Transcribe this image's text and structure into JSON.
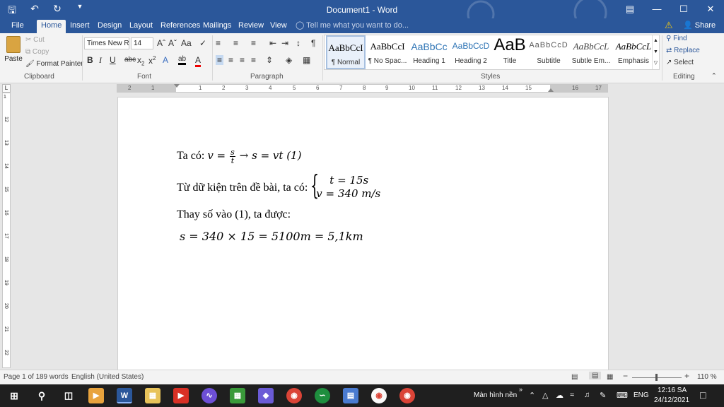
{
  "window": {
    "title": "Document1 - Word",
    "qat": {
      "save_icon": "save-icon",
      "undo_icon": "undo-icon",
      "redo_icon": "redo-icon",
      "customize_icon": "customize-qat-icon"
    },
    "controls": {
      "ribbon_display": "ribbon-display-icon",
      "minimize": "minimize-icon",
      "maximize": "maximize-icon",
      "close": "close-icon"
    }
  },
  "tabs": [
    {
      "label": "File"
    },
    {
      "label": "Home"
    },
    {
      "label": "Insert"
    },
    {
      "label": "Design"
    },
    {
      "label": "Layout"
    },
    {
      "label": "References"
    },
    {
      "label": "Mailings"
    },
    {
      "label": "Review"
    },
    {
      "label": "View"
    }
  ],
  "active_tab": "Home",
  "tell_me": "Tell me what you want to do...",
  "share_label": "Share",
  "clipboard": {
    "paste": "Paste",
    "cut": "Cut",
    "copy": "Copy",
    "format_painter": "Format Painter",
    "group_label": "Clipboard"
  },
  "font": {
    "family": "Times New R",
    "size": "14",
    "group_label": "Font"
  },
  "paragraph": {
    "group_label": "Paragraph"
  },
  "styles": {
    "group_label": "Styles",
    "items": [
      {
        "sample": "AaBbCcI",
        "name": "¶ Normal"
      },
      {
        "sample": "AaBbCcI",
        "name": "¶ No Spac..."
      },
      {
        "sample": "AaBbCc",
        "name": "Heading 1"
      },
      {
        "sample": "AaBbCcD",
        "name": "Heading 2"
      },
      {
        "sample": "AaB",
        "name": "Title"
      },
      {
        "sample": "AaBbCcD",
        "name": "Subtitle"
      },
      {
        "sample": "AaBbCcL",
        "name": "Subtle Em..."
      },
      {
        "sample": "AaBbCcL",
        "name": "Emphasis"
      }
    ]
  },
  "editing": {
    "find": "Find",
    "replace": "Replace",
    "select": "Select",
    "group_label": "Editing"
  },
  "ruler": {
    "h_ticks": [
      "2",
      "1",
      "1",
      "2",
      "3",
      "4",
      "5",
      "6",
      "7",
      "8",
      "9",
      "10",
      "11",
      "12",
      "13",
      "14",
      "15",
      "16",
      "17",
      "18"
    ],
    "v_ticks": [
      "1",
      "12",
      "13",
      "14",
      "15",
      "16",
      "17",
      "18",
      "19",
      "20",
      "21",
      "22",
      "23"
    ]
  },
  "document": {
    "line1_text": "Ta có: ",
    "line1_math_a": "v =",
    "line1_frac_num": "s",
    "line1_frac_den": "t",
    "line1_math_b": "→ s = vt (1)",
    "line2_text": "Từ dữ kiện trên đề bài, ta có:",
    "line2_eq1": "t = 15s",
    "line2_eq2": "v = 340 m/s",
    "line3_text": "Thay số vào (1), ta được:",
    "line4_math": "s = 340 × 15 = 5100m = 5,1km"
  },
  "status": {
    "page": "Page 1 of 1",
    "words": "89 words",
    "language": "English (United States)",
    "zoom": "110 %"
  },
  "taskbar": {
    "tray_label": "Màn hình nền",
    "language": "ENG",
    "time": "12:16 SA",
    "date": "24/12/2021"
  },
  "colors": {
    "title_bar": "#2b579a",
    "ribbon": "#f3f3f3",
    "taskbar": "#1f1f1f"
  }
}
